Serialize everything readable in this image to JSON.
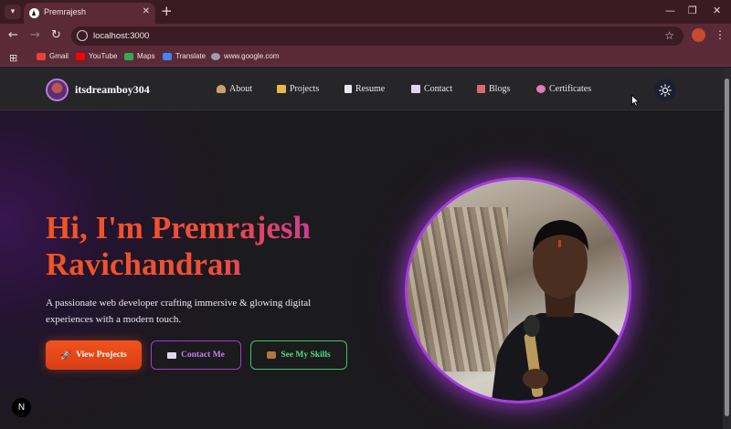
{
  "browser": {
    "tab_title": "Premrajesh",
    "url": "localhost:3000",
    "bookmarks": [
      {
        "label": "Gmail",
        "icon": "gmail-icon",
        "color": "#ea4335"
      },
      {
        "label": "YouTube",
        "icon": "youtube-icon",
        "color": "#ff0000"
      },
      {
        "label": "Maps",
        "icon": "maps-icon",
        "color": "#34a853"
      },
      {
        "label": "Translate",
        "icon": "translate-icon",
        "color": "#4285f4"
      },
      {
        "label": "www.google.com",
        "icon": "globe-icon",
        "color": "#9aa0a6"
      }
    ]
  },
  "site": {
    "brand": "itsdreamboy304",
    "nav": [
      {
        "label": "About",
        "icon": "person-icon",
        "color": "#c9a26b"
      },
      {
        "label": "Projects",
        "icon": "folder-icon",
        "color": "#e9b64a"
      },
      {
        "label": "Resume",
        "icon": "document-icon",
        "color": "#e8e8f0"
      },
      {
        "label": "Contact",
        "icon": "envelope-icon",
        "color": "#e2d6ee"
      },
      {
        "label": "Blogs",
        "icon": "notebook-icon",
        "color": "#d96a6a"
      },
      {
        "label": "Certificates",
        "icon": "brain-icon",
        "color": "#e07bb8"
      }
    ],
    "theme_toggle_icon": "sun-icon"
  },
  "hero": {
    "title_line1": "Hi, I'm Premrajesh",
    "title_line2": "Ravichandran",
    "description": "A passionate web developer crafting immersive & glowing digital experiences with a modern touch.",
    "buttons": {
      "projects": {
        "label": "View Projects",
        "icon": "rocket-icon"
      },
      "contact": {
        "label": "Contact Me",
        "icon": "envelope-icon"
      },
      "skills": {
        "label": "See My Skills",
        "icon": "briefcase-icon"
      }
    },
    "accent_colors": {
      "orange": "#f1551f",
      "purple": "#a935c9",
      "green": "#3ec46f"
    }
  },
  "dev_badge": "N"
}
